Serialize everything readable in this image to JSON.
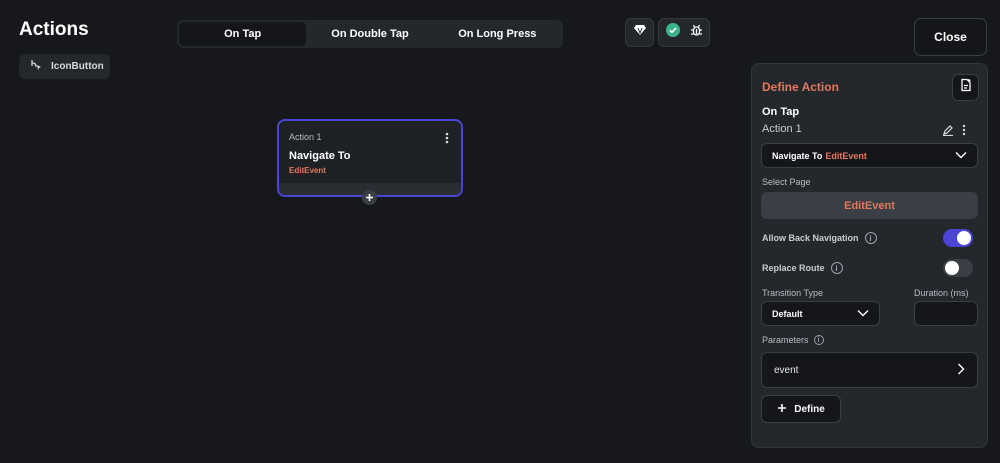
{
  "header": {
    "title": "Actions",
    "widget_label": "IconButton",
    "close_label": "Close"
  },
  "tabs": [
    {
      "label": "On Tap",
      "active": true
    },
    {
      "label": "On Double Tap",
      "active": false
    },
    {
      "label": "On Long Press",
      "active": false
    }
  ],
  "node": {
    "label": "Action 1",
    "title": "Navigate To",
    "target": "EditEvent"
  },
  "panel": {
    "title": "Define Action",
    "trigger": "On Tap",
    "action_name": "Action 1",
    "action_type": "Navigate To",
    "action_target": "EditEvent",
    "select_page_label": "Select Page",
    "selected_page": "EditEvent",
    "allow_back_label": "Allow Back Navigation",
    "allow_back_on": true,
    "replace_route_label": "Replace Route",
    "replace_route_on": false,
    "transition_label": "Transition Type",
    "transition_value": "Default",
    "duration_label": "Duration (ms)",
    "duration_value": "",
    "parameters_label": "Parameters",
    "parameter_name": "event",
    "define_label": "Define"
  },
  "colors": {
    "accent": "#e2795a",
    "primary": "#4b45d6",
    "background": "#16181b",
    "success": "#3bb38a"
  },
  "icons": {
    "widget": "branch-pointer-icon",
    "gem": "gem-icon",
    "check": "check-circle-icon",
    "bug": "bug-icon",
    "node_menu": "more-vertical-icon",
    "add": "plus-icon",
    "doc": "document-add-icon",
    "edit": "pencil-icon",
    "chevron": "chevron-down-icon",
    "arrow": "chevron-right-icon",
    "info": "info-icon"
  }
}
